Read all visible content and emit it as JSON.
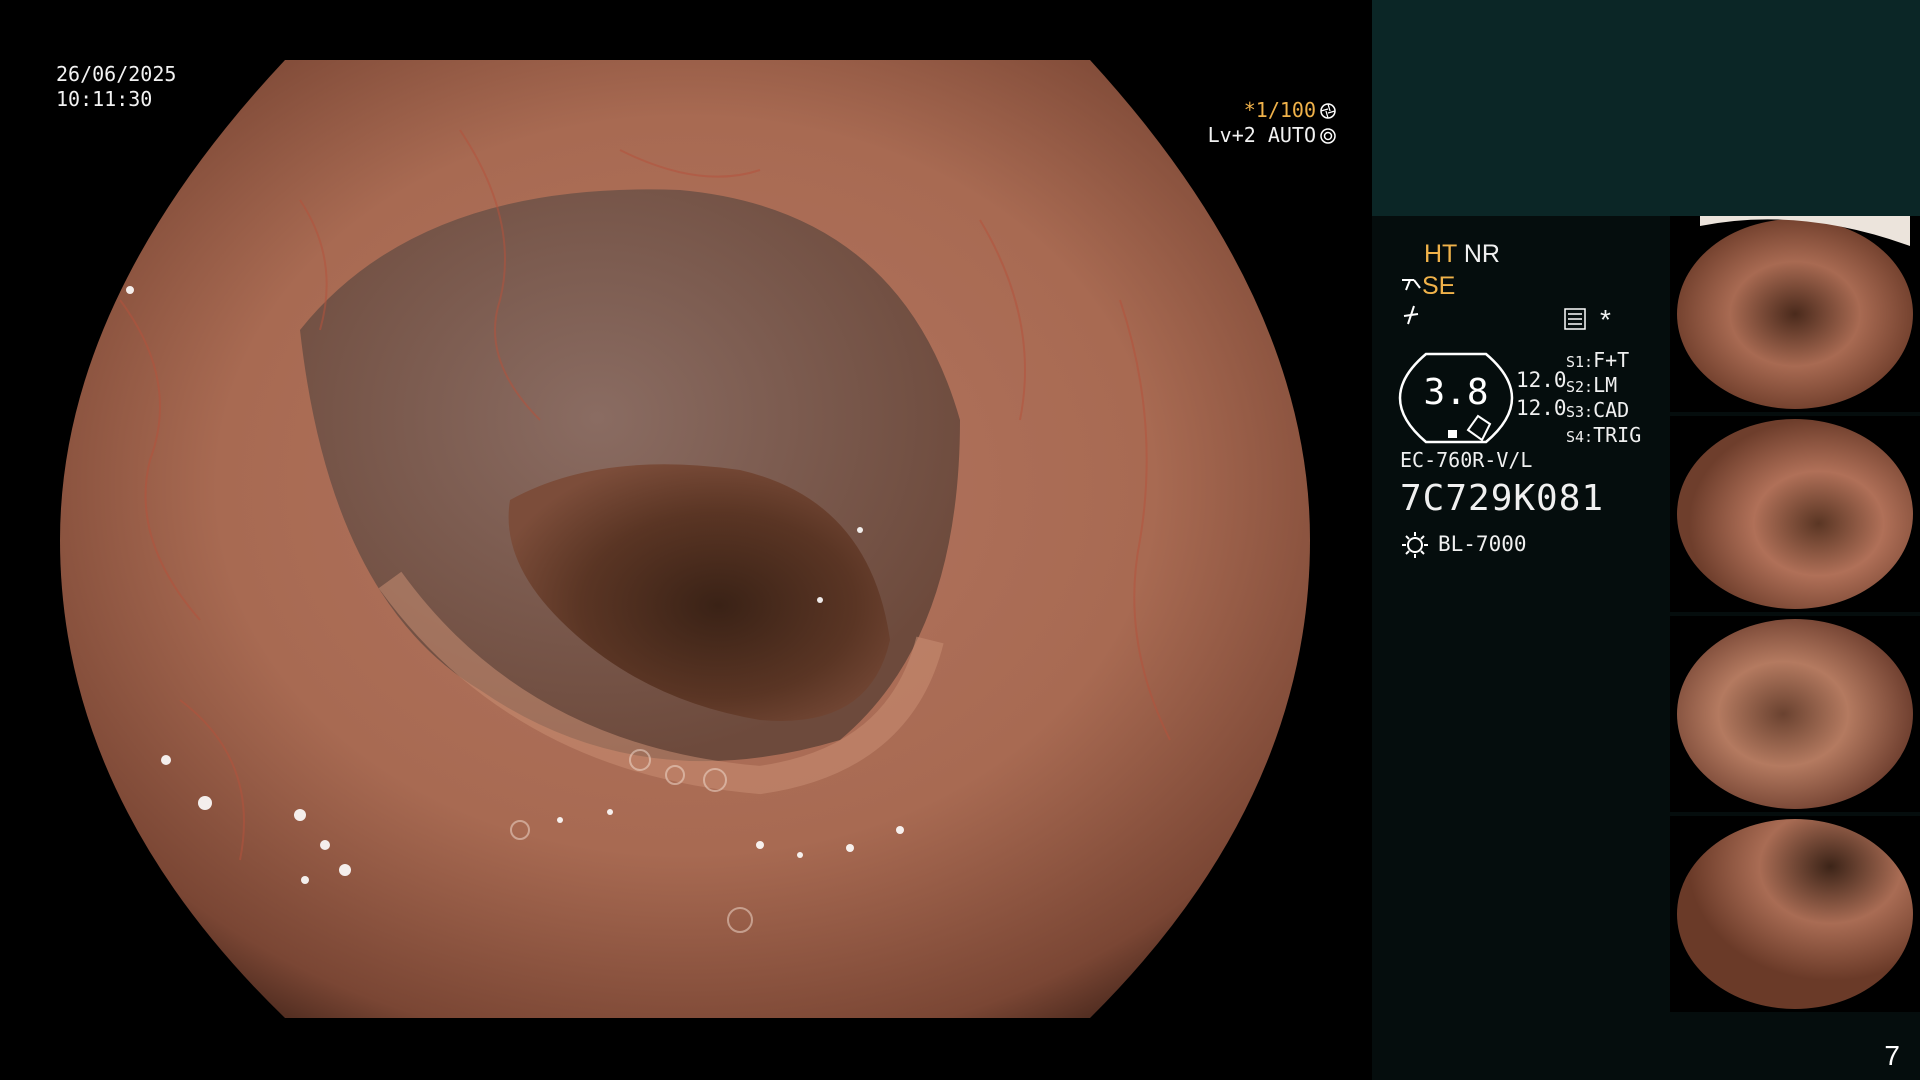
{
  "main": {
    "date": "26/06/2025",
    "time": "10:11:30",
    "exposure": "*1/100",
    "level": "Lv+2 AUTO"
  },
  "panel": {
    "mode_ht": "HT",
    "mode_nr": "NR",
    "mode_se": "SE",
    "gauge_value": "3.8",
    "gauge_left": "12.0",
    "gauge_right": "12.0",
    "scope_settings": [
      {
        "key": "S1:",
        "value": "F+T"
      },
      {
        "key": "S2:",
        "value": "LM"
      },
      {
        "key": "S3:",
        "value": "CAD"
      },
      {
        "key": "S4:",
        "value": "TRIG"
      }
    ],
    "star": "*",
    "scope_model": "EC-760R-V/L",
    "scope_serial": "7C729K081",
    "light_source": "BL-7000",
    "page_number": "7"
  },
  "thumbnails": [
    {
      "name": "thumbnail-1"
    },
    {
      "name": "thumbnail-2"
    },
    {
      "name": "thumbnail-3"
    },
    {
      "name": "thumbnail-4"
    }
  ],
  "colors": {
    "panel_top": "#0b2626",
    "panel_bg": "#050d0d",
    "accent_orange": "#f0b24a",
    "tissue": "#b5735a"
  }
}
